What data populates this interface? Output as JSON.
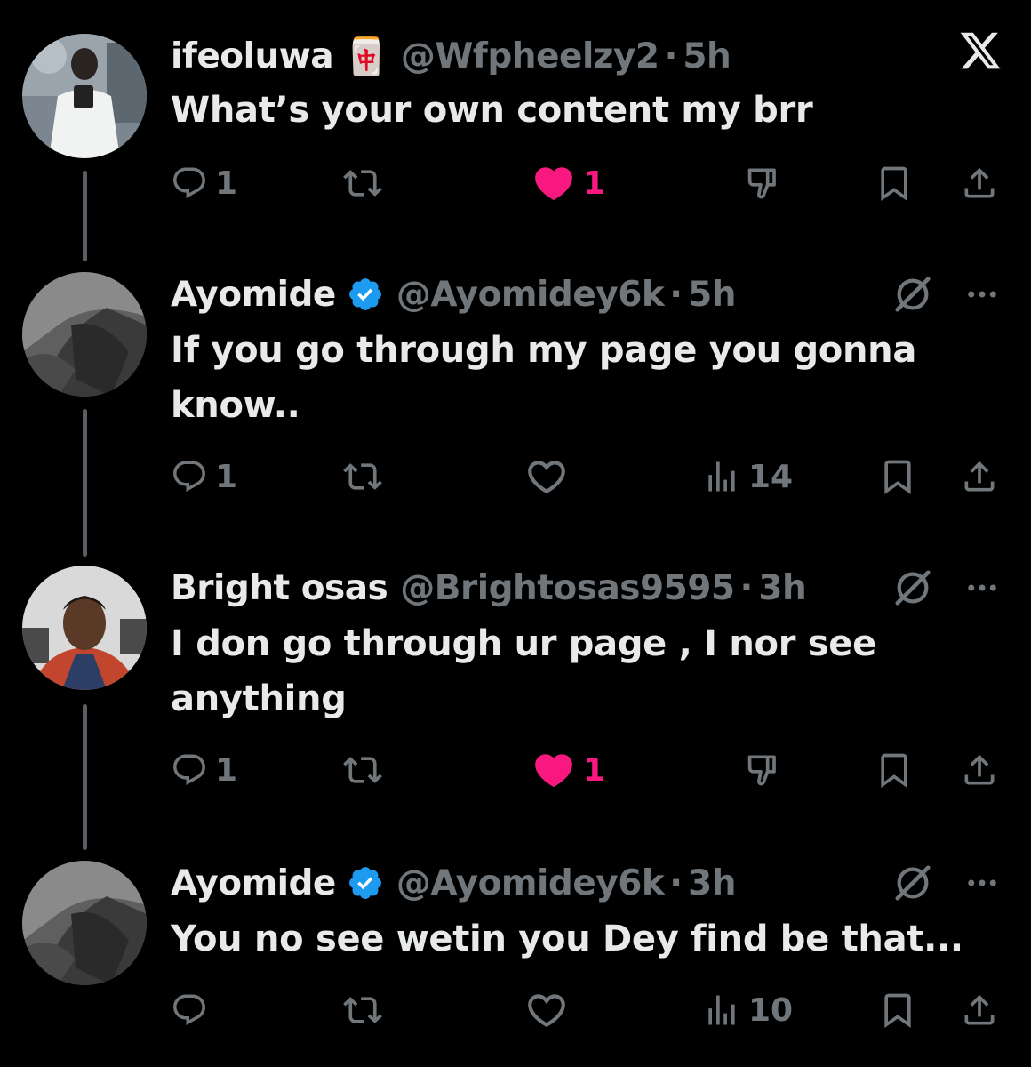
{
  "tweets": [
    {
      "name": "ifeoluwa",
      "name_emoji": "🀄",
      "handle": "@Wfpheelzy2",
      "dot": "·",
      "time": "5h",
      "text": "What’s your own content my brr",
      "reply_count": "1",
      "like_count": "1",
      "liked": true,
      "icons": [
        "reply-icon",
        "retweet-icon",
        "heart-filled-icon",
        "thumbs-down-icon",
        "bookmark-icon",
        "share-icon"
      ],
      "corner_icon": "x-logo-icon"
    },
    {
      "name": "Ayomide",
      "verified": true,
      "handle": "@Ayomidey6k",
      "dot": "·",
      "time": "5h",
      "text": "If you go through my page you gonna know..",
      "reply_count": "1",
      "views": "14",
      "liked": false,
      "icons": [
        "reply-icon",
        "retweet-icon",
        "heart-outline-icon",
        "views-icon",
        "bookmark-icon",
        "share-icon"
      ],
      "corner_icons": [
        "grok-icon",
        "more-options-icon"
      ]
    },
    {
      "name": "Bright osas",
      "handle": "@Brightosas9595",
      "dot": "·",
      "time": "3h",
      "text": "I don go through ur page , I nor see anything",
      "reply_count": "1",
      "like_count": "1",
      "liked": true,
      "icons": [
        "reply-icon",
        "retweet-icon",
        "heart-filled-icon",
        "thumbs-down-icon",
        "bookmark-icon",
        "share-icon"
      ],
      "corner_icons": [
        "grok-icon",
        "more-options-icon"
      ]
    },
    {
      "name": "Ayomide",
      "verified": true,
      "handle": "@Ayomidey6k",
      "dot": "·",
      "time": "3h",
      "text": "You no see wetin you Dey find be that...",
      "views": "10",
      "liked": false,
      "icons": [
        "reply-icon",
        "retweet-icon",
        "heart-outline-icon",
        "views-icon",
        "bookmark-icon",
        "share-icon"
      ],
      "corner_icons": [
        "grok-icon",
        "more-options-icon"
      ]
    }
  ],
  "colors": {
    "background": "#000000",
    "text": "#e7e9ea",
    "muted": "#71767b",
    "like": "#f91880",
    "verified": "#1d9bf0"
  }
}
